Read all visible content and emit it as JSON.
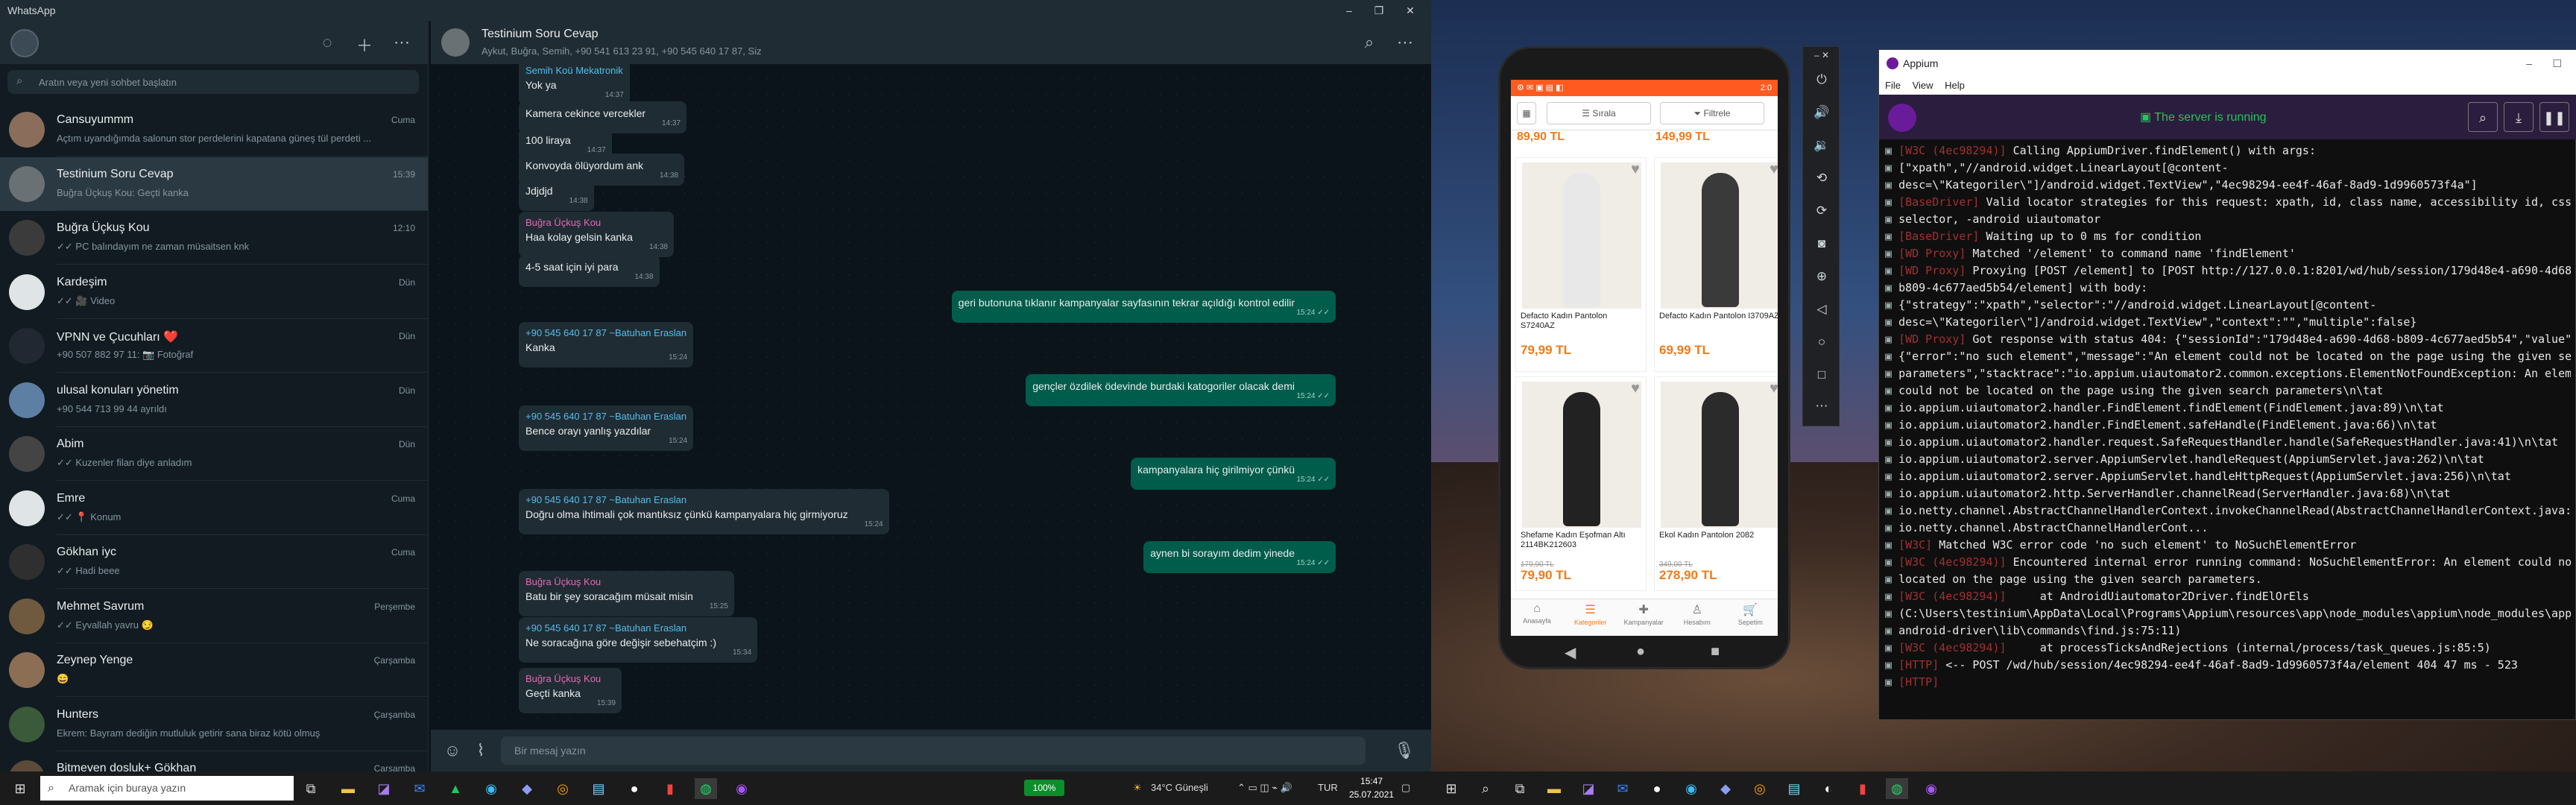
{
  "whatsapp": {
    "title": "WhatsApp",
    "search_placeholder": "Aratın veya yeni sohbet başlatın",
    "chats": [
      {
        "name": "Cansuyummm",
        "preview": "Açtım uyandığımda salonun stor perdelerini kapatana güneş tül perdeti ...",
        "time": "Cuma",
        "color": "#8a6d5a"
      },
      {
        "name": "Testinium Soru Cevap",
        "preview": "Buğra Üçkuş Kou: Geçti kanka",
        "time": "15:39",
        "color": "#6a7175"
      },
      {
        "name": "Buğra Üçkuş Kou",
        "preview": "✓✓ PC balındayım ne zaman müsaitsen knk",
        "time": "12:10",
        "color": "#3b3b3b"
      },
      {
        "name": "Kardeşim",
        "preview": "✓✓ 🎥 Video",
        "time": "Dün",
        "color": "#dfe5e7"
      },
      {
        "name": "VPNN ve Çucuhları ❤️",
        "preview": "+90 507 882 97 11: 📷 Fotoğraf",
        "time": "Dün",
        "color": "#222831"
      },
      {
        "name": "ulusal konuları yönetim",
        "preview": "+90 544 713 99 44 ayrıldı",
        "time": "Dün",
        "color": "#5d7fa3"
      },
      {
        "name": "Abim",
        "preview": "✓✓ Kuzenler filan diye anladım",
        "time": "Dün",
        "color": "#444"
      },
      {
        "name": "Emre",
        "preview": "✓✓ 📍 Konum",
        "time": "Cuma",
        "color": "#dfe5e7"
      },
      {
        "name": "Gökhan iyc",
        "preview": "✓✓ Hadi beee",
        "time": "Cuma",
        "color": "#2f2f2f"
      },
      {
        "name": "Mehmet Savrum",
        "preview": "✓✓ Eyvallah yavru 😏",
        "time": "Perşembe",
        "color": "#6f5a3f"
      },
      {
        "name": "Zeynep Yenge",
        "preview": "😄",
        "time": "Çarşamba",
        "color": "#8c6e55"
      },
      {
        "name": "Hunters",
        "preview": "Ekrem: Bayram dediğin mutluluk getirir sana biraz kötü olmuş",
        "time": "Çarşamba",
        "color": "#3a5a3a"
      },
      {
        "name": "Bitmeyen dosluk+ Gökhan",
        "preview": "",
        "time": "Çarşamba",
        "color": "#5a4a3a"
      }
    ],
    "conversation": {
      "title": "Testinium Soru Cevap",
      "subtitle": "Aykut, Buğra, Semih, +90 541 613 23 91, +90 545 640 17 87, Siz",
      "compose_placeholder": "Bir mesaj yazın",
      "messages": [
        {
          "dir": "in",
          "sender": "Semih Koü Mekatronik",
          "sender_color": "#53bdeb",
          "text": "Yok ya",
          "time": "14:37"
        },
        {
          "dir": "in",
          "sender": "",
          "text": "Kamera cekince vercekler",
          "time": "14:37"
        },
        {
          "dir": "in",
          "sender": "",
          "text": "100 liraya",
          "time": "14:37"
        },
        {
          "dir": "in",
          "sender": "",
          "text": "Konvoyda ölüyordum ank",
          "time": "14:38"
        },
        {
          "dir": "in",
          "sender": "",
          "text": "Jdjdjd",
          "time": "14:38"
        },
        {
          "dir": "in",
          "sender": "Buğra Üçkuş Kou",
          "sender_color": "#e26ab6",
          "text": "Haa kolay gelsin kanka",
          "time": "14:38"
        },
        {
          "dir": "in",
          "sender": "",
          "text": "4-5 saat için iyi para",
          "time": "14:38"
        },
        {
          "dir": "out",
          "sender": "",
          "text": "geri butonuna tıklanır kampanyalar sayfasının tekrar açıldığı kontrol edilir",
          "time": "15:24 ✓✓"
        },
        {
          "dir": "in",
          "sender": "+90 545 640 17 87 ~Batuhan Eraslan",
          "sender_color": "#53bdeb",
          "text": "Kanka",
          "time": "15:24"
        },
        {
          "dir": "out",
          "sender": "",
          "text": "gençler özdilek ödevinde burdaki katogoriler olacak demi",
          "time": "15:24 ✓✓"
        },
        {
          "dir": "in",
          "sender": "+90 545 640 17 87 ~Batuhan Eraslan",
          "sender_color": "#53bdeb",
          "text": "Bence orayı yanlış yazdılar",
          "time": "15:24"
        },
        {
          "dir": "out",
          "sender": "",
          "text": "kampanyalara hiç girilmiyor çünkü",
          "time": "15:24 ✓✓"
        },
        {
          "dir": "in",
          "sender": "+90 545 640 17 87 ~Batuhan Eraslan",
          "sender_color": "#53bdeb",
          "text": "Doğru olma ihtimali çok mantıksız çünkü kampanyalara hiç girmiyoruz",
          "time": "15:24"
        },
        {
          "dir": "out",
          "sender": "",
          "text": "aynen bi sorayım dedim yinede",
          "time": "15:24 ✓✓"
        },
        {
          "dir": "in",
          "sender": "Buğra Üçkuş Kou",
          "sender_color": "#e26ab6",
          "text": "Batu bir şey soracağım müsait misin",
          "time": "15:25"
        },
        {
          "dir": "in",
          "sender": "+90 545 640 17 87 ~Batuhan Eraslan",
          "sender_color": "#53bdeb",
          "text": "Ne soracağına göre değişir sebehatçim :)",
          "time": "15:34"
        },
        {
          "dir": "in",
          "sender": "Buğra Üçkuş Kou",
          "sender_color": "#e26ab6",
          "text": "Geçti kanka",
          "time": "15:39"
        }
      ]
    }
  },
  "phone": {
    "status_time": "2:0",
    "sort_label": "Sırala",
    "filter_label": "Filtrele",
    "top_prices": [
      "89,90 TL",
      "149,99 TL"
    ],
    "products": [
      {
        "name": "Defacto Kadın Pantolon S7240AZ",
        "old_price": "",
        "price": "79,99 TL",
        "fig": "#e8e8e8"
      },
      {
        "name": "Defacto Kadın Pantolon I3709AZ",
        "old_price": "",
        "price": "69,99 TL",
        "fig": "#3a3a3a"
      },
      {
        "name": "Shefame Kadın Eşofman Altı 2114BK212603",
        "old_price": "179,90 TL",
        "price": "79,90 TL",
        "fig": "#222"
      },
      {
        "name": "Ekol Kadın Pantolon 2082",
        "old_price": "349,00 TL",
        "price": "278,90 TL",
        "fig": "#2b2b2b"
      }
    ],
    "nav": [
      "Anasayfa",
      "Kategoriler",
      "Kampanyalar",
      "Hesabım",
      "Sepetim"
    ]
  },
  "appium": {
    "title": "Appium",
    "menu": [
      "File",
      "View",
      "Help"
    ],
    "status": "The server is running",
    "log": [
      [
        "[W3C (4ec98294)]",
        " Calling AppiumDriver.findElement() with args:"
      ],
      [
        "",
        "[\"xpath\",\"//android.widget.LinearLayout[@content-"
      ],
      [
        "",
        "desc=\\\"Kategoriler\\\"]/android.widget.TextView\",\"4ec98294-ee4f-46af-8ad9-1d9960573f4a\"]"
      ],
      [
        "[BaseDriver]",
        " Valid locator strategies for this request: xpath, id, class name, accessibility id, css"
      ],
      [
        "",
        "selector, -android uiautomator"
      ],
      [
        "[BaseDriver]",
        " Waiting up to 0 ms for condition"
      ],
      [
        "[WD Proxy]",
        " Matched '/element' to command name 'findElement'"
      ],
      [
        "[WD Proxy]",
        " Proxying [POST /element] to [POST http://127.0.0.1:8201/wd/hub/session/179d48e4-a690-4d68-"
      ],
      [
        "",
        "b809-4c677aed5b54/element] with body:"
      ],
      [
        "",
        "{\"strategy\":\"xpath\",\"selector\":\"//android.widget.LinearLayout[@content-"
      ],
      [
        "",
        "desc=\\\"Kategoriler\\\"]/android.widget.TextView\",\"context\":\"\",\"multiple\":false}"
      ],
      [
        "[WD Proxy]",
        " Got response with status 404: {\"sessionId\":\"179d48e4-a690-4d68-b809-4c677aed5b54\",\"value\":"
      ],
      [
        "",
        "{\"error\":\"no such element\",\"message\":\"An element could not be located on the page using the given search"
      ],
      [
        "",
        "parameters\",\"stacktrace\":\"io.appium.uiautomator2.common.exceptions.ElementNotFoundException: An element"
      ],
      [
        "",
        "could not be located on the page using the given search parameters\\n\\tat"
      ],
      [
        "",
        "io.appium.uiautomator2.handler.FindElement.findElement(FindElement.java:89)\\n\\tat"
      ],
      [
        "",
        "io.appium.uiautomator2.handler.FindElement.safeHandle(FindElement.java:66)\\n\\tat"
      ],
      [
        "",
        "io.appium.uiautomator2.handler.request.SafeRequestHandler.handle(SafeRequestHandler.java:41)\\n\\tat"
      ],
      [
        "",
        "io.appium.uiautomator2.server.AppiumServlet.handleRequest(AppiumServlet.java:262)\\n\\tat"
      ],
      [
        "",
        "io.appium.uiautomator2.server.AppiumServlet.handleHttpRequest(AppiumServlet.java:256)\\n\\tat"
      ],
      [
        "",
        "io.appium.uiautomator2.http.ServerHandler.channelRead(ServerHandler.java:68)\\n\\tat"
      ],
      [
        "",
        "io.netty.channel.AbstractChannelHandlerContext.invokeChannelRead(AbstractChannelHandlerContext.java:366"
      ],
      [
        "",
        "io.netty.channel.AbstractChannelHandlerCont..."
      ],
      [
        "[W3C]",
        " Matched W3C error code 'no such element' to NoSuchElementError"
      ],
      [
        "[W3C (4ec98294)]",
        " Encountered internal error running command: NoSuchElementError: An element could not be"
      ],
      [
        "",
        "located on the page using the given search parameters."
      ],
      [
        "[W3C (4ec98294)]",
        "     at AndroidUiautomator2Driver.findElOrEls"
      ],
      [
        "",
        "(C:\\Users\\testinium\\AppData\\Local\\Programs\\Appium\\resources\\app\\node_modules\\appium\\node_modules\\appium-"
      ],
      [
        "",
        "android-driver\\lib\\commands\\find.js:75:11)"
      ],
      [
        "[W3C (4ec98294)]",
        "     at processTicksAndRejections (internal/process/task_queues.js:85:5)"
      ],
      [
        "[HTTP]",
        " <-- POST /wd/hub/session/4ec98294-ee4f-46af-8ad9-1d9960573f4a/element 404 47 ms - 523"
      ],
      [
        "[HTTP]",
        ""
      ]
    ]
  },
  "taskbar": {
    "search_placeholder": "Aramak için buraya yazın",
    "battery": "100%",
    "weather": "34°C Güneşli",
    "language": "TUR",
    "time": "15:47",
    "date": "25.07.2021"
  }
}
